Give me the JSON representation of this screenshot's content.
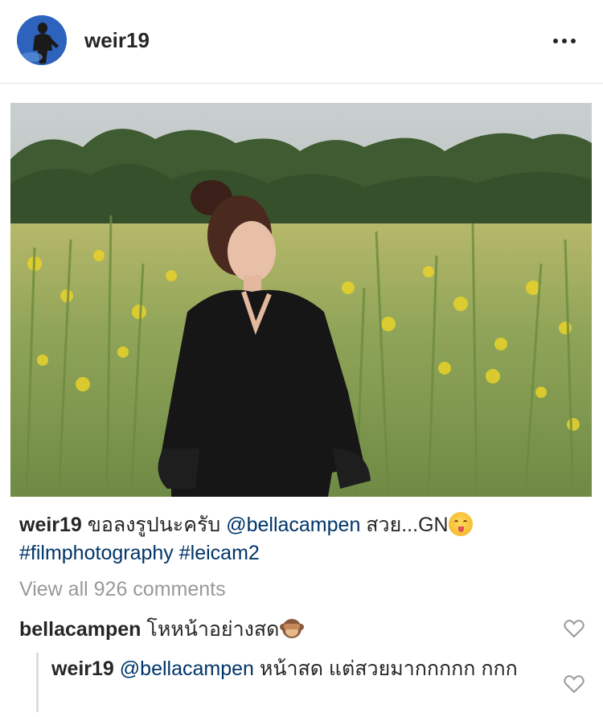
{
  "post": {
    "username": "weir19",
    "more_icon": "more-options-icon",
    "photo_alt": "woman-in-flower-field"
  },
  "caption": {
    "username": "weir19",
    "text_1": " ขอลงรูปนะครับ ",
    "mention": "@bellacampen",
    "text_2": " สวย...GN",
    "emoji": "smiling-face-savoring-food-emoji",
    "hashtag_1": "#filmphotography",
    "hashtag_2": "#leicam2"
  },
  "view_all_comments": "View all 926 comments",
  "comments": [
    {
      "username": "bellacampen",
      "text": " โหหน้าอย่างสด",
      "emoji": "see-no-evil-monkey-emoji"
    }
  ],
  "replies": [
    {
      "username": "weir19",
      "mention": "@bellacampen",
      "text": " หน้าสด แต่สวยมากกกกก กกก"
    }
  ],
  "colors": {
    "text": "#262626",
    "link": "#003569",
    "muted": "#999999",
    "divider": "#e0e0e0"
  }
}
